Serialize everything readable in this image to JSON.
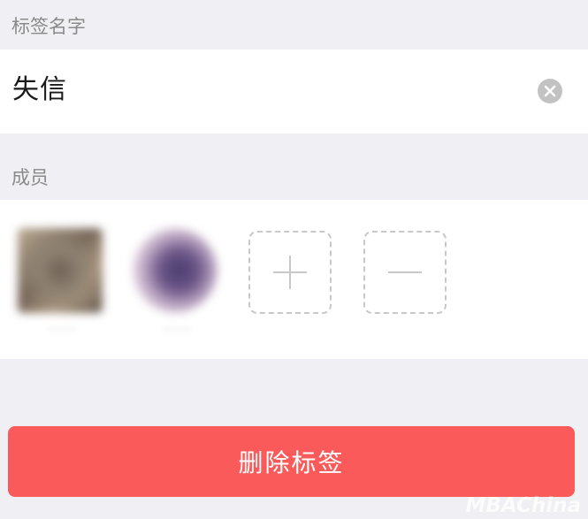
{
  "tag_name_section": {
    "label": "标签名字",
    "input_value": "失信"
  },
  "members_section": {
    "label": "成员",
    "members": [
      {
        "name": "········"
      },
      {
        "name": "········"
      }
    ]
  },
  "actions": {
    "delete_label": "删除标签"
  },
  "watermark": "MBAChina",
  "colors": {
    "background": "#efeff4",
    "delete_button": "#fa5a5a",
    "clear_icon": "#c2c2c2",
    "dashed_border": "#c8c8c8"
  },
  "icons": {
    "clear": "clear-icon",
    "add": "plus-icon",
    "remove": "minus-icon"
  }
}
